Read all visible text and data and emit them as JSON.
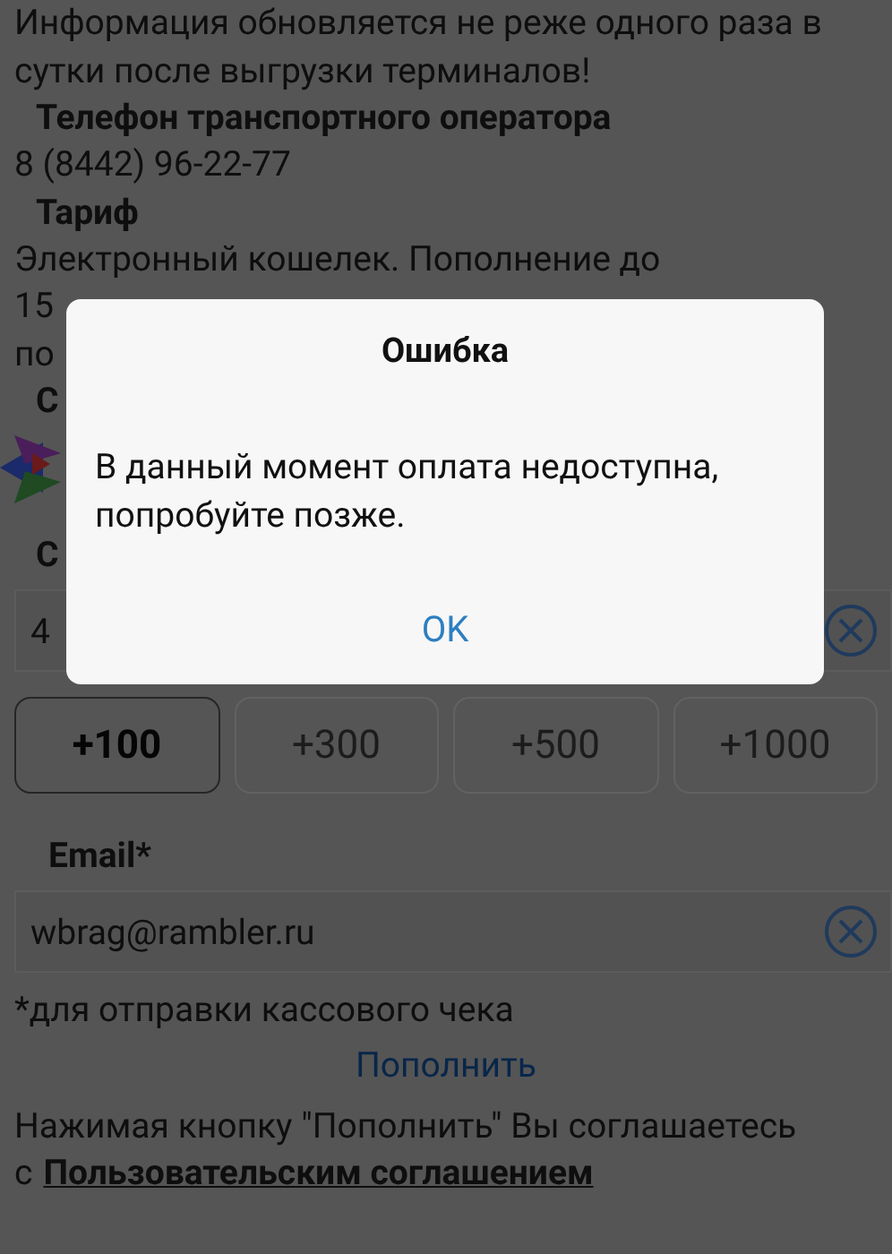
{
  "page": {
    "intro": "Информация обновляется не реже одного раза в сутки после выгрузки терминалов!",
    "phone_label": "Телефон транспортного оператора",
    "phone": "8 (8442) 96-22-77",
    "tariff_label": "Тариф",
    "tariff_lines": [
      "Электронный кошелек. Пополнение до",
      "15",
      "по"
    ],
    "section_label": "С",
    "amount_label": "С",
    "amount_value": "4",
    "amount_buttons": [
      {
        "label": "+100",
        "selected": true
      },
      {
        "label": "+300",
        "selected": false
      },
      {
        "label": "+500",
        "selected": false
      },
      {
        "label": "+1000",
        "selected": false
      }
    ],
    "email_label": "Email*",
    "email_value": "wbrag@rambler.ru",
    "email_note": "*для отправки кассового чека",
    "submit": "Пополнить",
    "agreement_text": "Нажимая кнопку \"Пополнить\" Вы соглашаетесь",
    "agreement_prefix": "с",
    "agreement_link": "Пользовательским соглашением"
  },
  "dialog": {
    "title": "Ошибка",
    "message": "В данный момент оплата недоступна, попробуйте позже.",
    "button": "OK"
  }
}
